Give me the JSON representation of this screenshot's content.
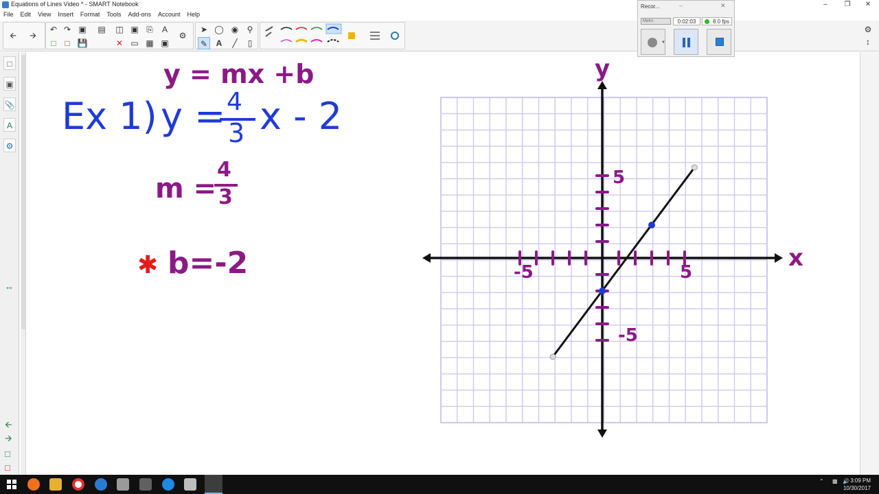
{
  "window": {
    "title": "Equations of Lines Video * - SMART Notebook"
  },
  "menu": [
    "File",
    "Edit",
    "View",
    "Insert",
    "Format",
    "Tools",
    "Add-ons",
    "Account",
    "Help"
  ],
  "recorder": {
    "title": "Recor...",
    "combo": "Metro",
    "time": "0:02:03",
    "fps": "8.0 fps"
  },
  "handwriting": {
    "formula": "y = mx +b",
    "example_label": "Ex 1)",
    "example_y": "y =",
    "frac_num": "4",
    "frac_den": "3",
    "example_rest": "x - 2",
    "slope_m": "m =",
    "slope_num": "4",
    "slope_den": "3",
    "star": "✱",
    "intercept": "b=-2"
  },
  "graph": {
    "y_axis_label": "y",
    "x_axis_label": "x",
    "tick_pos_x": "5",
    "tick_neg_x": "-5",
    "tick_pos_y": "5",
    "tick_neg_y": "-5"
  },
  "colors": {
    "purple_ink": "#8b1a86",
    "blue_ink": "#1f3bd6",
    "red_ink": "#e41b1b",
    "grid": "#cfc8ef",
    "black_ink": "#111111"
  },
  "taskbar": {
    "clock_time": "3:09 PM",
    "clock_date": "10/30/2017"
  }
}
